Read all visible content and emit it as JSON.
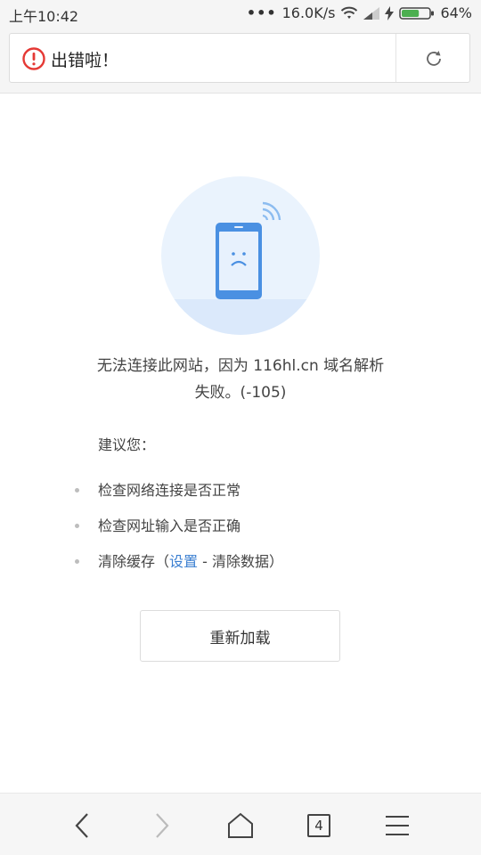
{
  "status_bar": {
    "time": "上午10:42",
    "network_speed": "16.0K/s",
    "battery": "64%",
    "battery_level_percent": 64
  },
  "address_bar": {
    "title": "出错啦！",
    "error_icon": "exclamation-circle-icon",
    "reload_icon": "refresh-icon"
  },
  "error_page": {
    "message_line1": "无法连接此网站，因为 116hl.cn 域名解析",
    "message_line2": "失败。(-105)",
    "suggest_title": "建议您：",
    "tips": {
      "tip1": "检查网络连接是否正常",
      "tip2": "检查网址输入是否正确",
      "tip3_prefix": "清除缓存（",
      "tip3_link": "设置",
      "tip3_suffix": " - 清除数据）"
    },
    "reload_label": "重新加载"
  },
  "bottom_bar": {
    "tab_count": "4",
    "icons": [
      "back-icon",
      "forward-icon",
      "home-icon",
      "tabs-icon",
      "menu-icon"
    ]
  },
  "colors": {
    "accent_link": "#3b7fd1",
    "error_red": "#e53935",
    "phone_blue": "#4a90e2",
    "circle_bg": "#eaf3fd"
  }
}
